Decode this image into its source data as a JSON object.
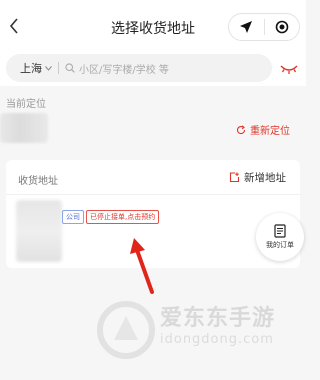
{
  "header": {
    "title": "选择收货地址"
  },
  "search": {
    "city": "上海",
    "placeholder": "小区/写字楼/学校 等"
  },
  "location": {
    "label": "当前定位",
    "relocate": "重新定位"
  },
  "addresses": {
    "heading": "收货地址",
    "add_label": "新增地址",
    "items": [
      {
        "tag_type": "公司",
        "tag_status": "已停止接单,点击预约"
      }
    ]
  },
  "floating": {
    "orders_label": "我的订单"
  },
  "watermark": {
    "brand": "爱东东手游",
    "url": "idongdong.com"
  },
  "colors": {
    "accent": "#e0352b",
    "company_tag": "#5470d8"
  },
  "icons": [
    "chevron-left-icon",
    "navigation-arrow-icon",
    "target-icon",
    "chevron-down-icon",
    "search-icon",
    "eye-closed-icon",
    "refresh-icon",
    "add-note-icon",
    "orders-icon",
    "red-arrow-annotation"
  ]
}
